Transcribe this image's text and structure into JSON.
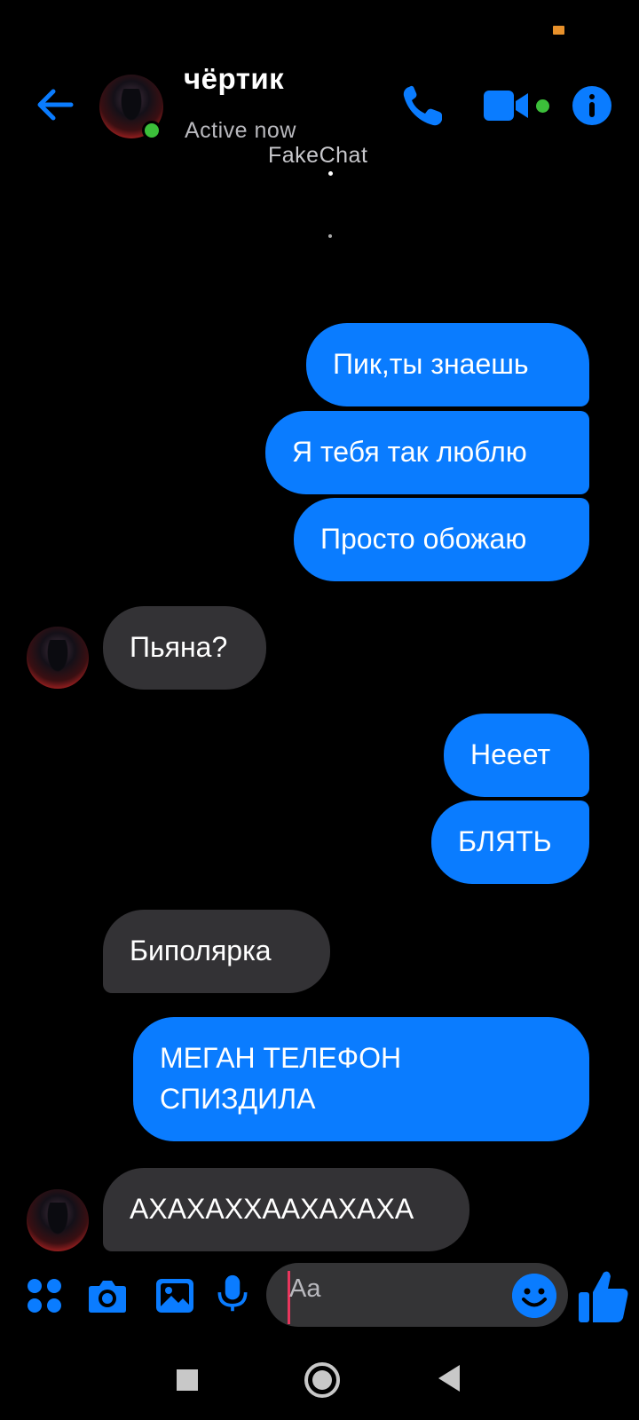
{
  "status_bar": {
    "indicator_color": "#e8912b"
  },
  "header": {
    "contact_name": "чёртик",
    "activity": "Active now",
    "watermark": "FakeChat",
    "icons": [
      "back-arrow-icon",
      "phone-icon",
      "video-camera-icon",
      "info-icon"
    ],
    "online_color": "#3cbf3a"
  },
  "messages": [
    {
      "direction": "out",
      "text": "Пик,ты знаешь"
    },
    {
      "direction": "out",
      "text": "Я тебя так люблю"
    },
    {
      "direction": "out",
      "text": "Просто обожаю"
    },
    {
      "direction": "in",
      "text": "Пьяна?"
    },
    {
      "direction": "out",
      "text": "Нееет"
    },
    {
      "direction": "out",
      "text": "БЛЯТЬ"
    },
    {
      "direction": "in",
      "text": "Биполярка"
    },
    {
      "direction": "out",
      "lines": [
        "МЕГАН ТЕЛЕФОН",
        "СПИЗДИЛА"
      ]
    },
    {
      "direction": "in",
      "text": "АХАХАХХААХАХАХА"
    }
  ],
  "composer": {
    "placeholder": "Aa",
    "tools": [
      "apps-grid-icon",
      "camera-icon",
      "gallery-icon",
      "microphone-icon"
    ],
    "emoji_icon": "smiley-icon",
    "send_icon": "thumbs-up-icon"
  },
  "colors": {
    "accent": "#0a7cff",
    "incoming_bubble": "#333235",
    "background": "#000000",
    "caret": "#e8365d"
  },
  "nav_bar": [
    "recents-square-icon",
    "home-circle-icon",
    "back-triangle-icon"
  ]
}
